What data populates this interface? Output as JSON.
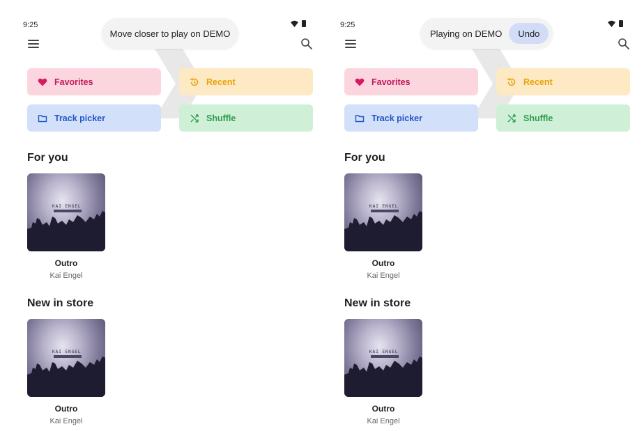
{
  "screens": [
    {
      "status_time": "9:25",
      "toast": {
        "message": "Move closer to play on DEMO"
      },
      "chips": {
        "favorites": "Favorites",
        "recent": "Recent",
        "track_picker": "Track picker",
        "shuffle": "Shuffle"
      },
      "sections": [
        {
          "title": "For you",
          "album": {
            "title": "Outro",
            "artist": "Kai Engel",
            "art_text": "KAI ENGEL"
          }
        },
        {
          "title": "New in store",
          "album": {
            "title": "Outro",
            "artist": "Kai Engel",
            "art_text": "KAI ENGEL"
          }
        }
      ]
    },
    {
      "status_time": "9:25",
      "toast": {
        "message": "Playing on DEMO",
        "action": "Undo"
      },
      "chips": {
        "favorites": "Favorites",
        "recent": "Recent",
        "track_picker": "Track picker",
        "shuffle": "Shuffle"
      },
      "sections": [
        {
          "title": "For you",
          "album": {
            "title": "Outro",
            "artist": "Kai Engel",
            "art_text": "KAI ENGEL"
          }
        },
        {
          "title": "New in store",
          "album": {
            "title": "Outro",
            "artist": "Kai Engel",
            "art_text": "KAI ENGEL"
          }
        }
      ]
    }
  ],
  "icons": {
    "status": [
      "wifi-icon",
      "battery-icon"
    ],
    "toolbar": [
      "menu-icon",
      "search-icon"
    ],
    "chips": [
      "heart-icon",
      "history-icon",
      "folder-icon",
      "shuffle-icon"
    ]
  },
  "colors": {
    "favorites_bg": "#fcd6de",
    "favorites_fg": "#c2185b",
    "recent_bg": "#fde9c3",
    "recent_fg": "#e8a20c",
    "track_bg": "#d3e0fa",
    "track_fg": "#2156c4",
    "shuffle_bg": "#cfefd7",
    "shuffle_fg": "#2e9e4f",
    "undo_bg": "#d3dcf7"
  }
}
